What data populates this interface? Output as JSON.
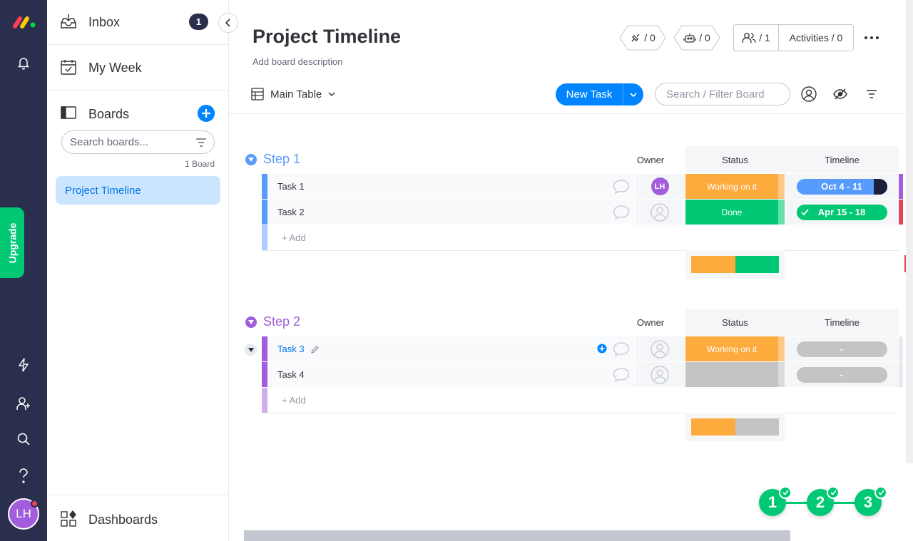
{
  "rail": {
    "upgrade_label": "Upgrade",
    "avatar_initials": "LH"
  },
  "sidebar": {
    "inbox_label": "Inbox",
    "inbox_count": "1",
    "myweek_label": "My Week",
    "boards_label": "Boards",
    "search_placeholder": "Search boards...",
    "board_count": "1 Board",
    "active_board": "Project Timeline",
    "dashboards_label": "Dashboards"
  },
  "header": {
    "title": "Project Timeline",
    "description": "Add board description",
    "integrations_count": "/ 0",
    "automations_count": "/ 0",
    "members_count": "/ 1",
    "activities_label": "Activities / 0"
  },
  "toolbar": {
    "view_label": "Main Table",
    "new_task_label": "New Task",
    "filter_placeholder": "Search / Filter Board"
  },
  "columns": {
    "owner": "Owner",
    "status": "Status",
    "timeline": "Timeline"
  },
  "groups": [
    {
      "title": "Step 1",
      "color": "#579bfc",
      "add_label": "+ Add",
      "rows": [
        {
          "name": "Task 1",
          "owner": "LH",
          "status": "Working on it",
          "status_color": "#fdab3d",
          "timeline": "Oct 4 - 11"
        },
        {
          "name": "Task 2",
          "owner": "",
          "status": "Done",
          "status_color": "#00c875",
          "timeline": "Apr 15 - 18"
        }
      ]
    },
    {
      "title": "Step 2",
      "color": "#a25ddc",
      "add_label": "+ Add",
      "rows": [
        {
          "name": "Task 3",
          "owner": "",
          "status": "Working on it",
          "status_color": "#fdab3d",
          "timeline": "-"
        },
        {
          "name": "Task 4",
          "owner": "",
          "status": "",
          "status_color": "#c4c4c4",
          "timeline": "-"
        }
      ]
    }
  ],
  "onboarding_steps": [
    "1",
    "2",
    "3"
  ],
  "colors": {
    "rail_bg": "#292f4c",
    "primary": "#0085ff",
    "success": "#00c875",
    "working": "#fdab3d",
    "empty": "#c4c4c4"
  }
}
